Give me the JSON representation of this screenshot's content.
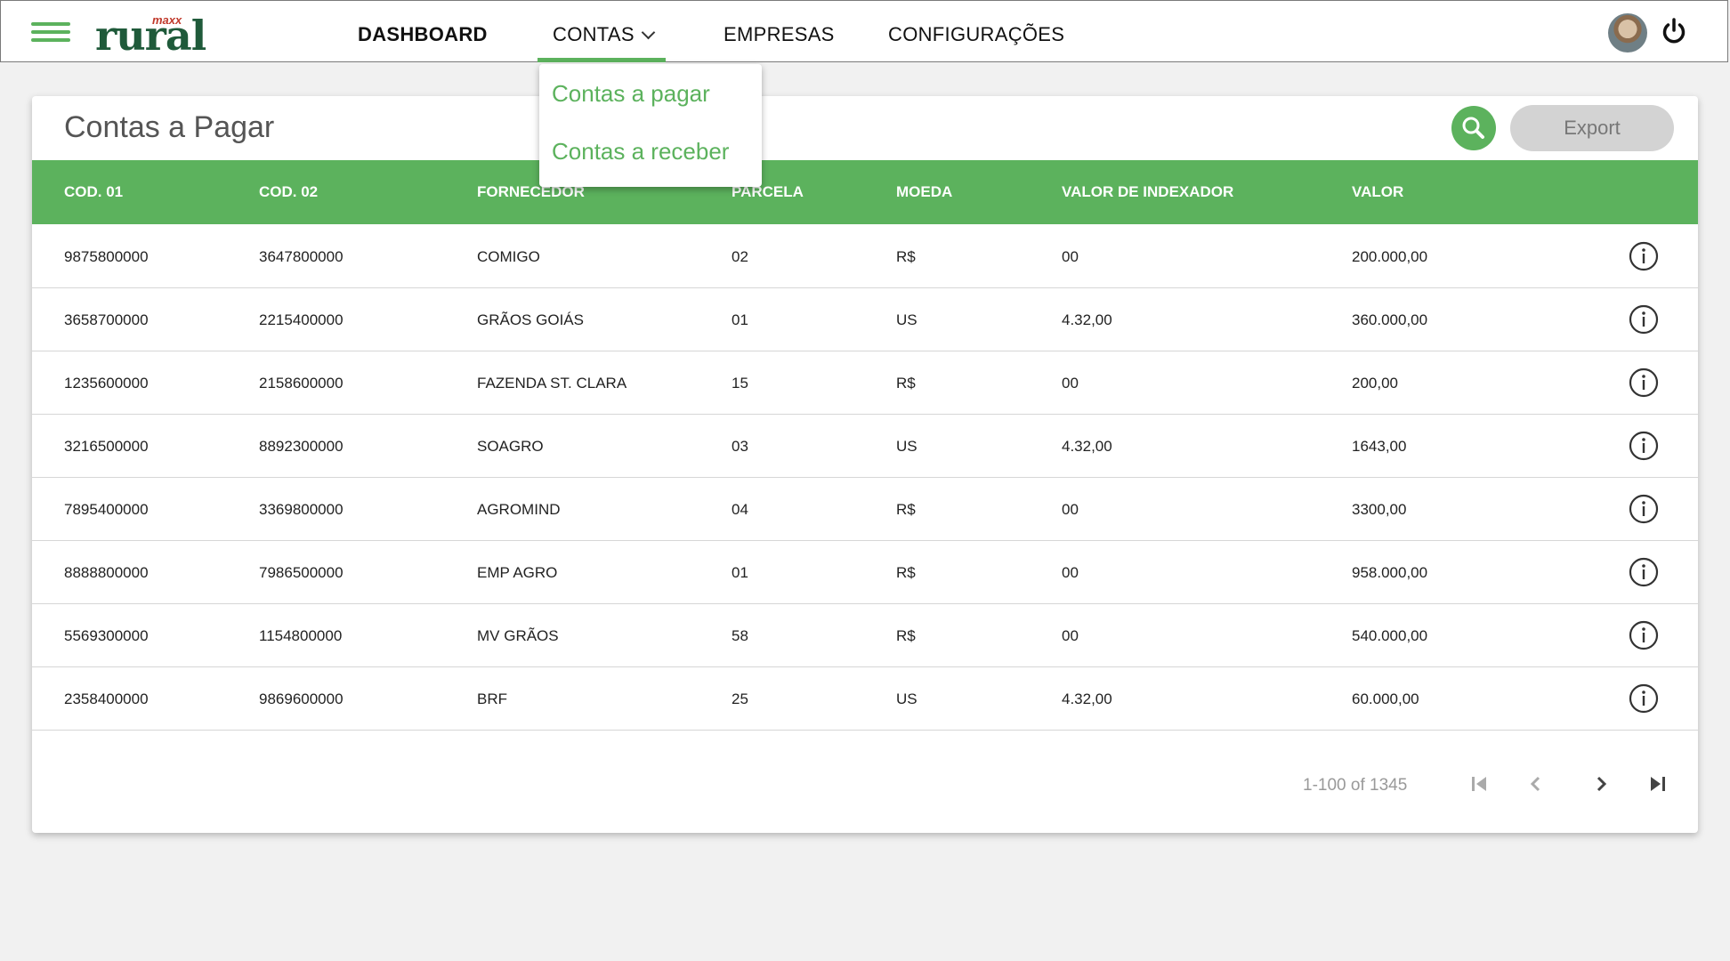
{
  "brand": {
    "logo_main": "rural",
    "logo_sup": "maxx"
  },
  "nav": {
    "items": [
      {
        "label": "DASHBOARD"
      },
      {
        "label": "CONTAS"
      },
      {
        "label": "EMPRESAS"
      },
      {
        "label": "CONFIGURAÇÕES"
      }
    ],
    "active": "CONTAS"
  },
  "dropdown": {
    "items": [
      {
        "label": "Contas a pagar"
      },
      {
        "label": "Contas a receber"
      }
    ]
  },
  "page": {
    "title": "Contas a Pagar",
    "export_label": "Export"
  },
  "table": {
    "headers": [
      "COD. 01",
      "COD. 02",
      "FORNECEDOR",
      "PARCELA",
      "MOEDA",
      "VALOR DE INDEXADOR",
      "VALOR"
    ],
    "rows": [
      [
        "9875800000",
        "3647800000",
        "COMIGO",
        "02",
        "R$",
        "00",
        "200.000,00"
      ],
      [
        "3658700000",
        "2215400000",
        "GRÃOS GOIÁS",
        "01",
        "US",
        "4.32,00",
        "360.000,00"
      ],
      [
        "1235600000",
        "2158600000",
        "FAZENDA ST. CLARA",
        "15",
        "R$",
        "00",
        "200,00"
      ],
      [
        "3216500000",
        "8892300000",
        "SOAGRO",
        "03",
        "US",
        "4.32,00",
        "1643,00"
      ],
      [
        "7895400000",
        "3369800000",
        "AGROMIND",
        "04",
        "R$",
        "00",
        "3300,00"
      ],
      [
        "8888800000",
        "7986500000",
        "EMP AGRO",
        "01",
        "R$",
        "00",
        "958.000,00"
      ],
      [
        "5569300000",
        "1154800000",
        "MV GRÃOS",
        "58",
        "R$",
        "00",
        "540.000,00"
      ],
      [
        "2358400000",
        "9869600000",
        "BRF",
        "25",
        "US",
        "4.32,00",
        "60.000,00"
      ]
    ]
  },
  "pagination": {
    "range_text": "1-100 of 1345"
  },
  "colors": {
    "accent": "#5cb25d",
    "logo": "#1f5a3a",
    "logo_sup": "#c0392b"
  }
}
